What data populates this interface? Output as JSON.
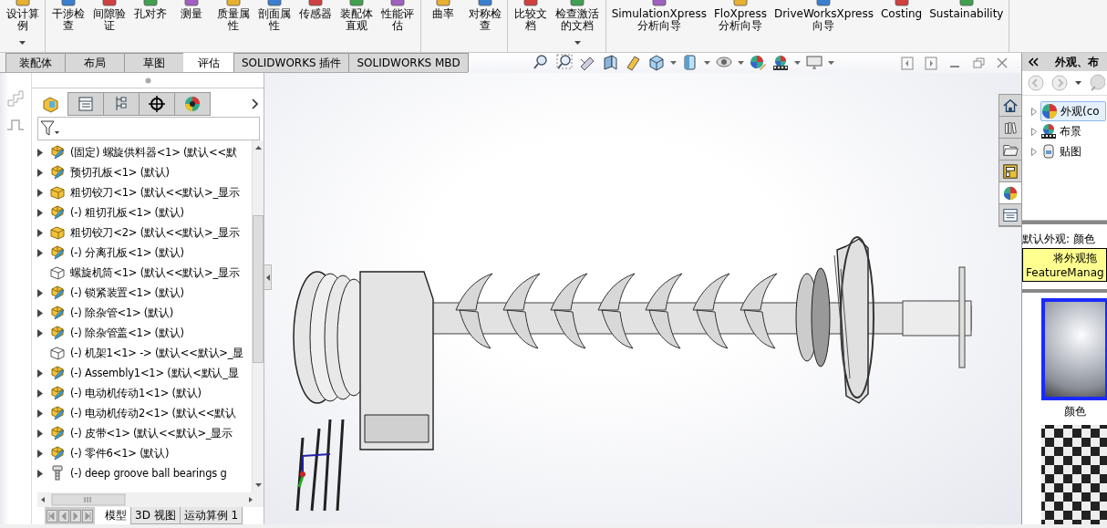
{
  "ribbon": {
    "groups": [
      [
        {
          "label": "设计算例",
          "menu": true
        }
      ],
      [
        {
          "label": "干涉检查",
          "menu": false
        },
        {
          "label": "间隙验证",
          "menu": false
        },
        {
          "label": "孔对齐",
          "menu": false
        },
        {
          "label": "测量",
          "menu": false
        },
        {
          "label": "质量属性",
          "menu": false
        },
        {
          "label": "剖面属性",
          "menu": false
        },
        {
          "label": "传感器",
          "menu": false
        },
        {
          "label": "装配体直观",
          "menu": false
        },
        {
          "label": "性能评估",
          "menu": false
        }
      ],
      [
        {
          "label": "曲率",
          "menu": false
        },
        {
          "label": "对称检查",
          "menu": false
        }
      ],
      [
        {
          "label": "比较文档",
          "menu": false
        },
        {
          "label": "检查激活的文档",
          "menu": true
        }
      ],
      [
        {
          "label": "SimulationXpress 分析向导",
          "menu": false
        },
        {
          "label": "FloXpress 分析向导",
          "menu": false
        },
        {
          "label": "DriveWorksXpress 向导",
          "menu": false
        },
        {
          "label": "Costing",
          "menu": false
        },
        {
          "label": "Sustainability",
          "menu": false
        }
      ]
    ]
  },
  "command_tabs": [
    {
      "label": "装配体",
      "selected": false
    },
    {
      "label": "布局",
      "selected": false
    },
    {
      "label": "草图",
      "selected": false
    },
    {
      "label": "评估",
      "selected": true
    },
    {
      "label": "SOLIDWORKS 插件",
      "selected": false
    },
    {
      "label": "SOLIDWORKS MBD",
      "selected": false
    }
  ],
  "feature_tree": {
    "panel_tabs": [
      {
        "kind": "feature-manager",
        "selected": true
      },
      {
        "kind": "property-manager",
        "selected": false
      },
      {
        "kind": "configuration-manager",
        "selected": false
      },
      {
        "kind": "dimxpert",
        "selected": false
      },
      {
        "kind": "display-manager",
        "selected": false
      }
    ],
    "items": [
      {
        "label": "(固定) 螺旋供料器<1> (默认<<默",
        "kind": "subassembly",
        "expandable": true
      },
      {
        "label": "预切孔板<1> (默认)",
        "kind": "subassembly",
        "expandable": true
      },
      {
        "label": "粗切铰刀<1> (默认<<默认>_显示",
        "kind": "part",
        "expandable": true
      },
      {
        "label": "(-) 粗切孔板<1> (默认)",
        "kind": "subassembly",
        "expandable": true
      },
      {
        "label": "粗切铰刀<2> (默认<<默认>_显示",
        "kind": "part",
        "expandable": true
      },
      {
        "label": "(-) 分离孔板<1> (默认)",
        "kind": "subassembly",
        "expandable": true
      },
      {
        "label": "螺旋机筒<1> (默认<<默认>_显示",
        "kind": "part-outline",
        "expandable": false
      },
      {
        "label": "(-) 锁紧装置<1> (默认)",
        "kind": "subassembly",
        "expandable": true
      },
      {
        "label": "(-) 除杂管<1> (默认)",
        "kind": "subassembly",
        "expandable": true
      },
      {
        "label": "(-) 除杂管盖<1> (默认)",
        "kind": "subassembly",
        "expandable": true
      },
      {
        "label": "(-) 机架1<1> -> (默认<<默认>_显",
        "kind": "part-outline",
        "expandable": false
      },
      {
        "label": "(-) Assembly1<1> (默认<默认_显",
        "kind": "subassembly",
        "expandable": true
      },
      {
        "label": "(-) 电动机传动1<1> (默认)",
        "kind": "subassembly",
        "expandable": true
      },
      {
        "label": "(-) 电动机传动2<1> (默认<<默认",
        "kind": "subassembly",
        "expandable": true
      },
      {
        "label": "(-) 皮带<1> (默认<<默认>_显示",
        "kind": "subassembly",
        "expandable": true
      },
      {
        "label": "(-) 零件6<1> (默认)",
        "kind": "subassembly",
        "expandable": true
      },
      {
        "label": "(-) deep groove ball bearings g",
        "kind": "bolt",
        "expandable": true
      }
    ],
    "bottom_tabs": [
      {
        "label": "模型",
        "selected": true
      },
      {
        "label": "3D 视图",
        "selected": false
      },
      {
        "label": "运动算例 1",
        "selected": false
      }
    ]
  },
  "task_pane": {
    "title": "外观、布",
    "side_tabs": [
      {
        "kind": "home",
        "selected": false
      },
      {
        "kind": "library",
        "selected": false
      },
      {
        "kind": "folder",
        "selected": false
      },
      {
        "kind": "palette",
        "selected": false
      },
      {
        "kind": "appearance",
        "selected": true
      },
      {
        "kind": "properties",
        "selected": false
      }
    ],
    "tree": [
      {
        "label": "外观(co",
        "kind": "appearance",
        "selected": true
      },
      {
        "label": "布景",
        "kind": "scene",
        "selected": false
      },
      {
        "label": "贴图",
        "kind": "decal",
        "selected": false
      }
    ],
    "caption": "默认外观: 颜色",
    "note": [
      "将外观拖",
      "FeatureManag"
    ],
    "swatches": [
      {
        "kind": "gloss",
        "label": "颜色",
        "selected": true
      },
      {
        "kind": "checker",
        "selected": false
      }
    ]
  }
}
